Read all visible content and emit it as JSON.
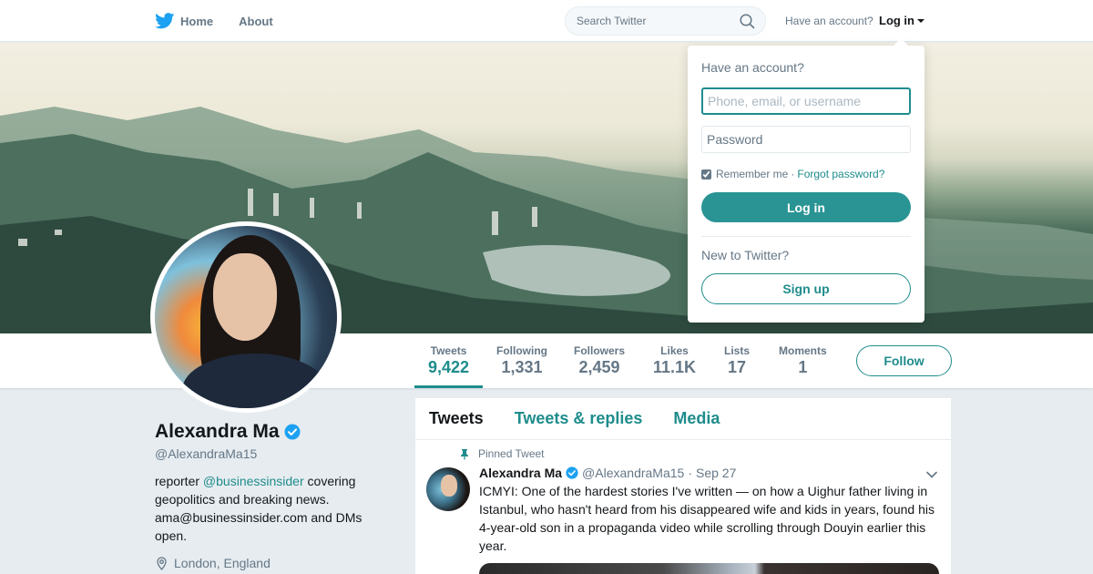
{
  "topnav": {
    "home_label": "Home",
    "about_label": "About",
    "search_placeholder": "Search Twitter",
    "have_account": "Have an account?",
    "login_label": "Log in"
  },
  "profile_nav": {
    "stats": [
      {
        "label": "Tweets",
        "value": "9,422"
      },
      {
        "label": "Following",
        "value": "1,331"
      },
      {
        "label": "Followers",
        "value": "2,459"
      },
      {
        "label": "Likes",
        "value": "11.1K"
      },
      {
        "label": "Lists",
        "value": "17"
      },
      {
        "label": "Moments",
        "value": "1"
      }
    ],
    "follow_label": "Follow"
  },
  "profile": {
    "name": "Alexandra Ma",
    "handle": "@AlexandraMa15",
    "bio_prefix": "reporter ",
    "bio_mention": "@businessinsider",
    "bio_suffix": " covering geopolitics and breaking news. ama@businessinsider.com and DMs open.",
    "location": "London, England"
  },
  "timeline": {
    "tabs": [
      "Tweets",
      "Tweets & replies",
      "Media"
    ],
    "pinned_label": "Pinned Tweet",
    "tweet": {
      "name": "Alexandra Ma",
      "handle": "@AlexandraMa15",
      "dot": "·",
      "time": "Sep 27",
      "text": "ICMYI: One of the hardest stories I've written — on how a Uighur father living in Istanbul, who hasn't heard from his disappeared wife and kids in years, found his 4-year-old son in a propaganda video while scrolling through Douyin earlier this year."
    }
  },
  "login_dropdown": {
    "title": "Have an account?",
    "username_placeholder": "Phone, email, or username",
    "password_placeholder": "Password",
    "remember_label": "Remember me",
    "separator": "·",
    "forgot_label": "Forgot password?",
    "login_button": "Log in",
    "new_label": "New to Twitter?",
    "signup_button": "Sign up"
  },
  "colors": {
    "accent": "#1f8c8c",
    "twitter_blue": "#1da1f2",
    "muted": "#657786"
  },
  "icons": [
    "twitter-bird-icon",
    "search-icon",
    "caret-down-icon",
    "verified-badge-icon",
    "location-pin-icon",
    "pin-icon",
    "chevron-down-icon",
    "checkbox-icon"
  ]
}
